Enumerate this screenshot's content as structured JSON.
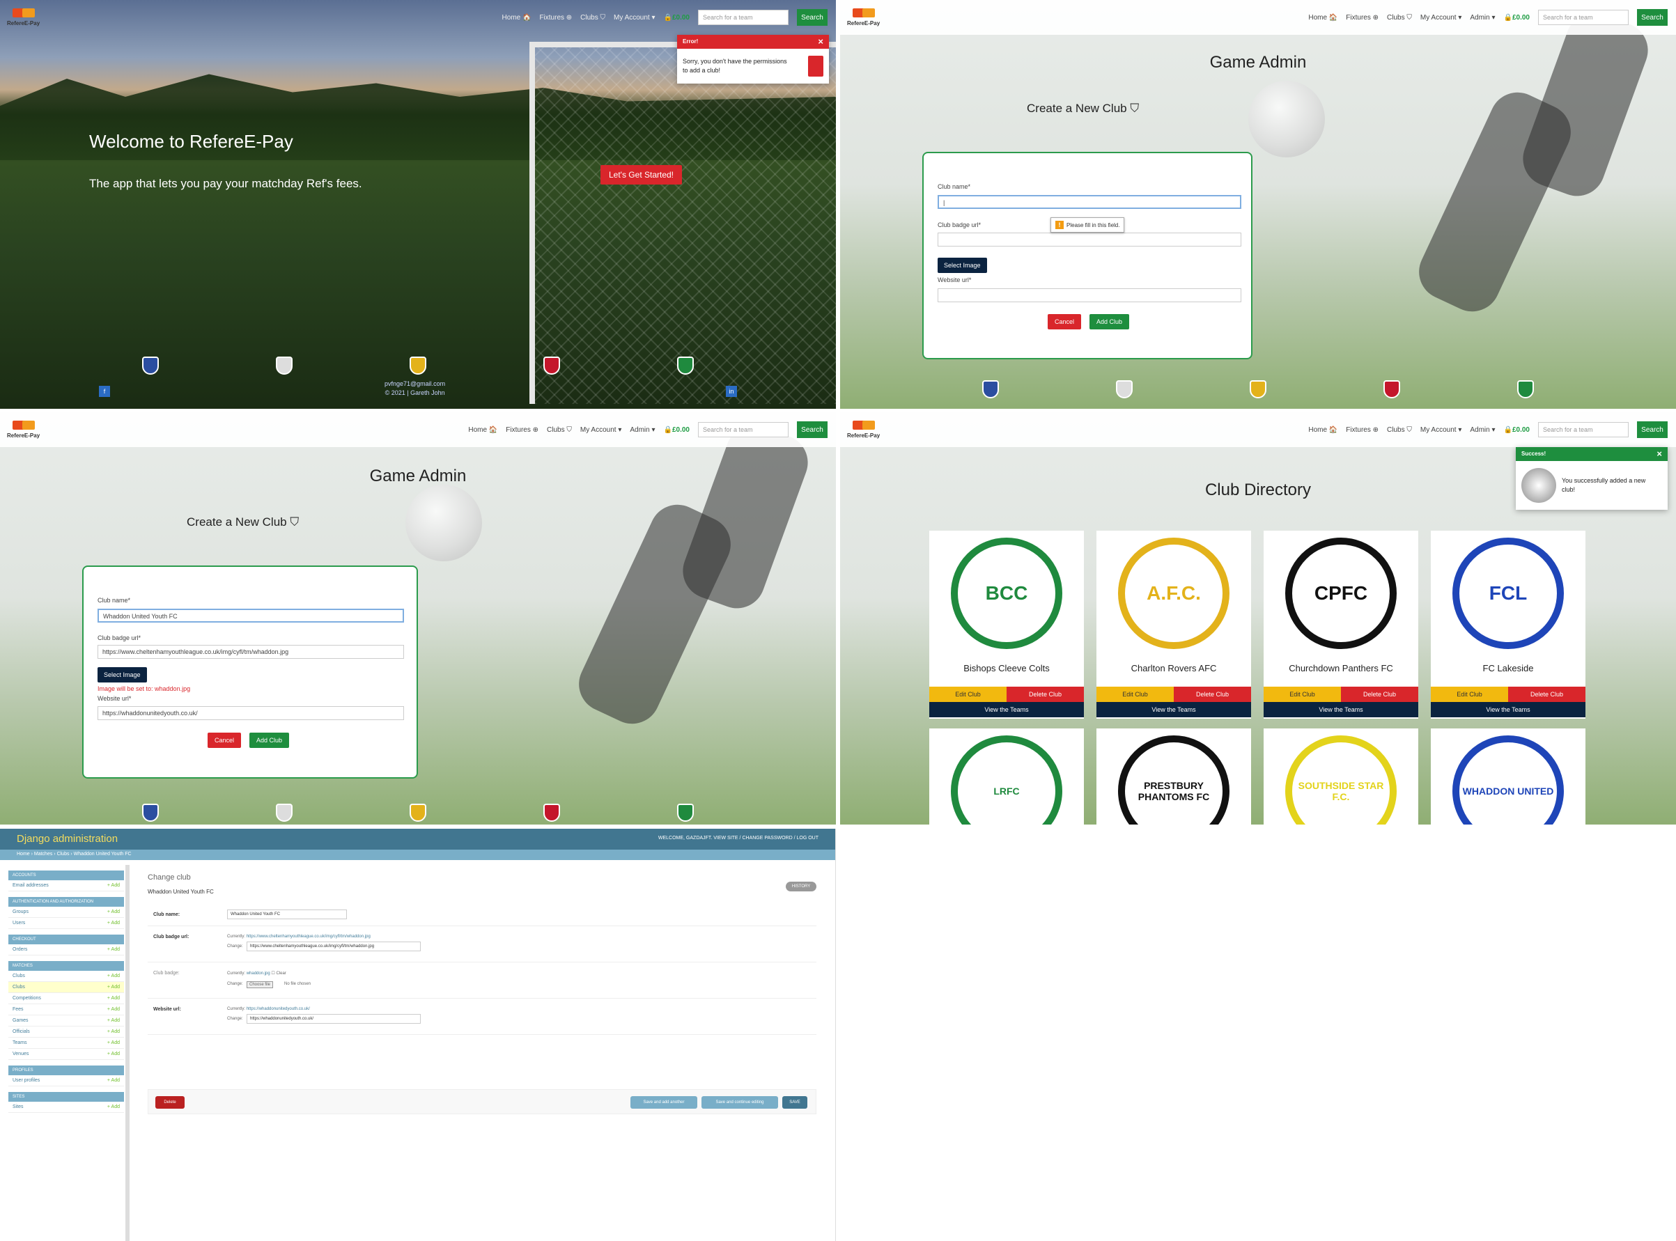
{
  "nav": {
    "logo": "RefereE-Pay",
    "home": "Home 🏠",
    "fixtures": "Fixtures ⊕",
    "clubs": "Clubs ⛉",
    "account": "My Account ▾",
    "admin": "Admin ▾",
    "cart": "🔒£0.00",
    "search_placeholder": "Search for a team",
    "search_btn": "Search"
  },
  "p1": {
    "title": "Welcome to RefereE-Pay",
    "subtitle": "The app that lets you pay your matchday Ref's fees.",
    "cta": "Let's Get Started!",
    "toast_title": "Error!",
    "toast_msg": "Sorry, you don't have the permissions to add a club!",
    "footer_email": "pvfnge71@gmail.com",
    "footer_copy": "© 2021 | Gareth John"
  },
  "p2": {
    "heading": "Game Admin",
    "sub": "Create a New Club",
    "club_name_lbl": "Club name*",
    "badge_lbl": "Club badge url*",
    "tooltip": "Please fill in this field.",
    "select_image": "Select Image",
    "website_lbl": "Website url*",
    "cancel": "Cancel",
    "add": "Add Club"
  },
  "p3": {
    "heading": "Game Admin",
    "sub": "Create a New Club",
    "club_name_lbl": "Club name*",
    "club_name_val": "Whaddon United Youth FC",
    "badge_lbl": "Club badge url*",
    "badge_val": "https://www.cheltenhamyouthleague.co.uk/img/cyfl/tm/whaddon.jpg",
    "select_image": "Select Image",
    "image_note": "Image will be set to: whaddon.jpg",
    "website_lbl": "Website url*",
    "website_val": "https://whaddonunitedyouth.co.uk/",
    "cancel": "Cancel",
    "add": "Add Club"
  },
  "p4": {
    "heading": "Club Directory",
    "toast_title": "Success!",
    "toast_msg": "You successfully added a new club!",
    "edit": "Edit Club",
    "delete": "Delete Club",
    "view": "View the Teams",
    "clubs": [
      {
        "name": "Bishops Cleeve Colts",
        "crest": "BCC",
        "color": "#1f8a3e"
      },
      {
        "name": "Charlton Rovers AFC",
        "crest": "A.F.C.",
        "color": "#e3b21b"
      },
      {
        "name": "Churchdown Panthers FC",
        "crest": "CPFC",
        "color": "#111111"
      },
      {
        "name": "FC Lakeside",
        "crest": "FCL",
        "color": "#1e45b8"
      }
    ],
    "clubs2": [
      {
        "crest": "LRFC",
        "color": "#1f8a3e"
      },
      {
        "crest": "PRESTBURY PHANTOMS FC",
        "color": "#111111"
      },
      {
        "crest": "SOUTHSIDE STAR F.C.",
        "color": "#e3d31b"
      },
      {
        "crest": "WHADDON UNITED",
        "color": "#1e45b8"
      }
    ]
  },
  "dj": {
    "brand": "Django administration",
    "user": "WELCOME, GAZDAJFT. VIEW SITE / CHANGE PASSWORD / LOG OUT",
    "crumb": "Home › Matches › Clubs › Whaddon United Youth FC",
    "title": "Change club",
    "object": "Whaddon United Youth FC",
    "history": "HISTORY",
    "club_name_lbl": "Club name:",
    "club_name_val": "Whaddon United Youth FC",
    "badge_url_lbl": "Club badge url:",
    "currently": "Currently:",
    "change": "Change:",
    "badge_url_cur": "https://www.cheltenhamyouthleague.co.uk/img/cyfl/tm/whaddon.jpg",
    "badge_url_val": "https://www.cheltenhamyouthleague.co.uk/img/cyfl/tm/whaddon.jpg",
    "badge_lbl": "Club badge:",
    "badge_cur": "whaddon.jpg",
    "clear": "Clear",
    "choose": "Choose file",
    "no_file": "No file chosen",
    "website_lbl": "Website url:",
    "website_cur": "https://whaddonunitedyouth.co.uk/",
    "website_val": "https://whaddonunitedyouth.co.uk/",
    "delete": "Delete",
    "save_add": "Save and add another",
    "save_cont": "Save and continue editing",
    "save": "SAVE",
    "add": "+ Add",
    "sections": [
      {
        "cap": "Accounts",
        "rows": [
          "Email addresses"
        ]
      },
      {
        "cap": "Authentication and Authorization",
        "rows": [
          "Groups",
          "Users"
        ]
      },
      {
        "cap": "Checkout",
        "rows": [
          "Orders"
        ]
      },
      {
        "cap": "Matches",
        "rows": [
          "Clubs",
          "Clubs",
          "Competitions",
          "Fees",
          "Games",
          "Officials",
          "Teams",
          "Venues"
        ]
      },
      {
        "cap": "Profiles",
        "rows": [
          "User profiles"
        ]
      },
      {
        "cap": "Sites",
        "rows": [
          "Sites"
        ]
      }
    ]
  }
}
